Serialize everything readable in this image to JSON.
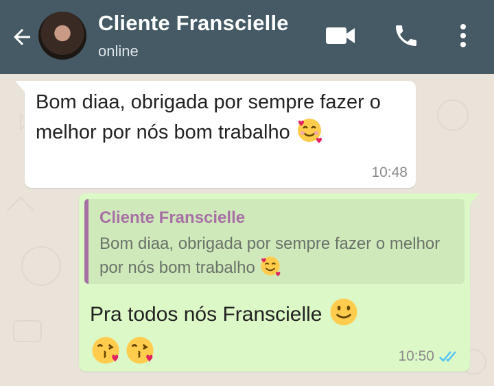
{
  "header": {
    "contact_name": "Cliente Franscielle",
    "status": "online",
    "colors": {
      "bar": "#455a64",
      "text": "#ffffff"
    },
    "icons": [
      "back-arrow-icon",
      "video-call-icon",
      "phone-icon",
      "more-options-icon"
    ]
  },
  "messages": {
    "incoming": {
      "text": "Bom diaa, obrigada por sempre fazer o melhor por nós bom trabalho",
      "emoji": "smiling-face-with-hearts",
      "time": "10:48",
      "bubble_color": "#ffffff"
    },
    "outgoing": {
      "quote": {
        "author": "Cliente Franscielle",
        "text": "Bom diaa, obrigada por sempre fazer o melhor por nós bom trabalho",
        "emoji": "smiling-face-with-hearts",
        "accent": "#a770a5"
      },
      "text": "Pra todos nós Franscielle",
      "text_emoji": "slightly-smiling-face",
      "extra_emojis": [
        "face-blowing-kiss",
        "face-blowing-kiss"
      ],
      "time": "10:50",
      "ticks": "read",
      "bubble_color": "#dcf8c6",
      "tick_color": "#4fc3f7"
    }
  }
}
